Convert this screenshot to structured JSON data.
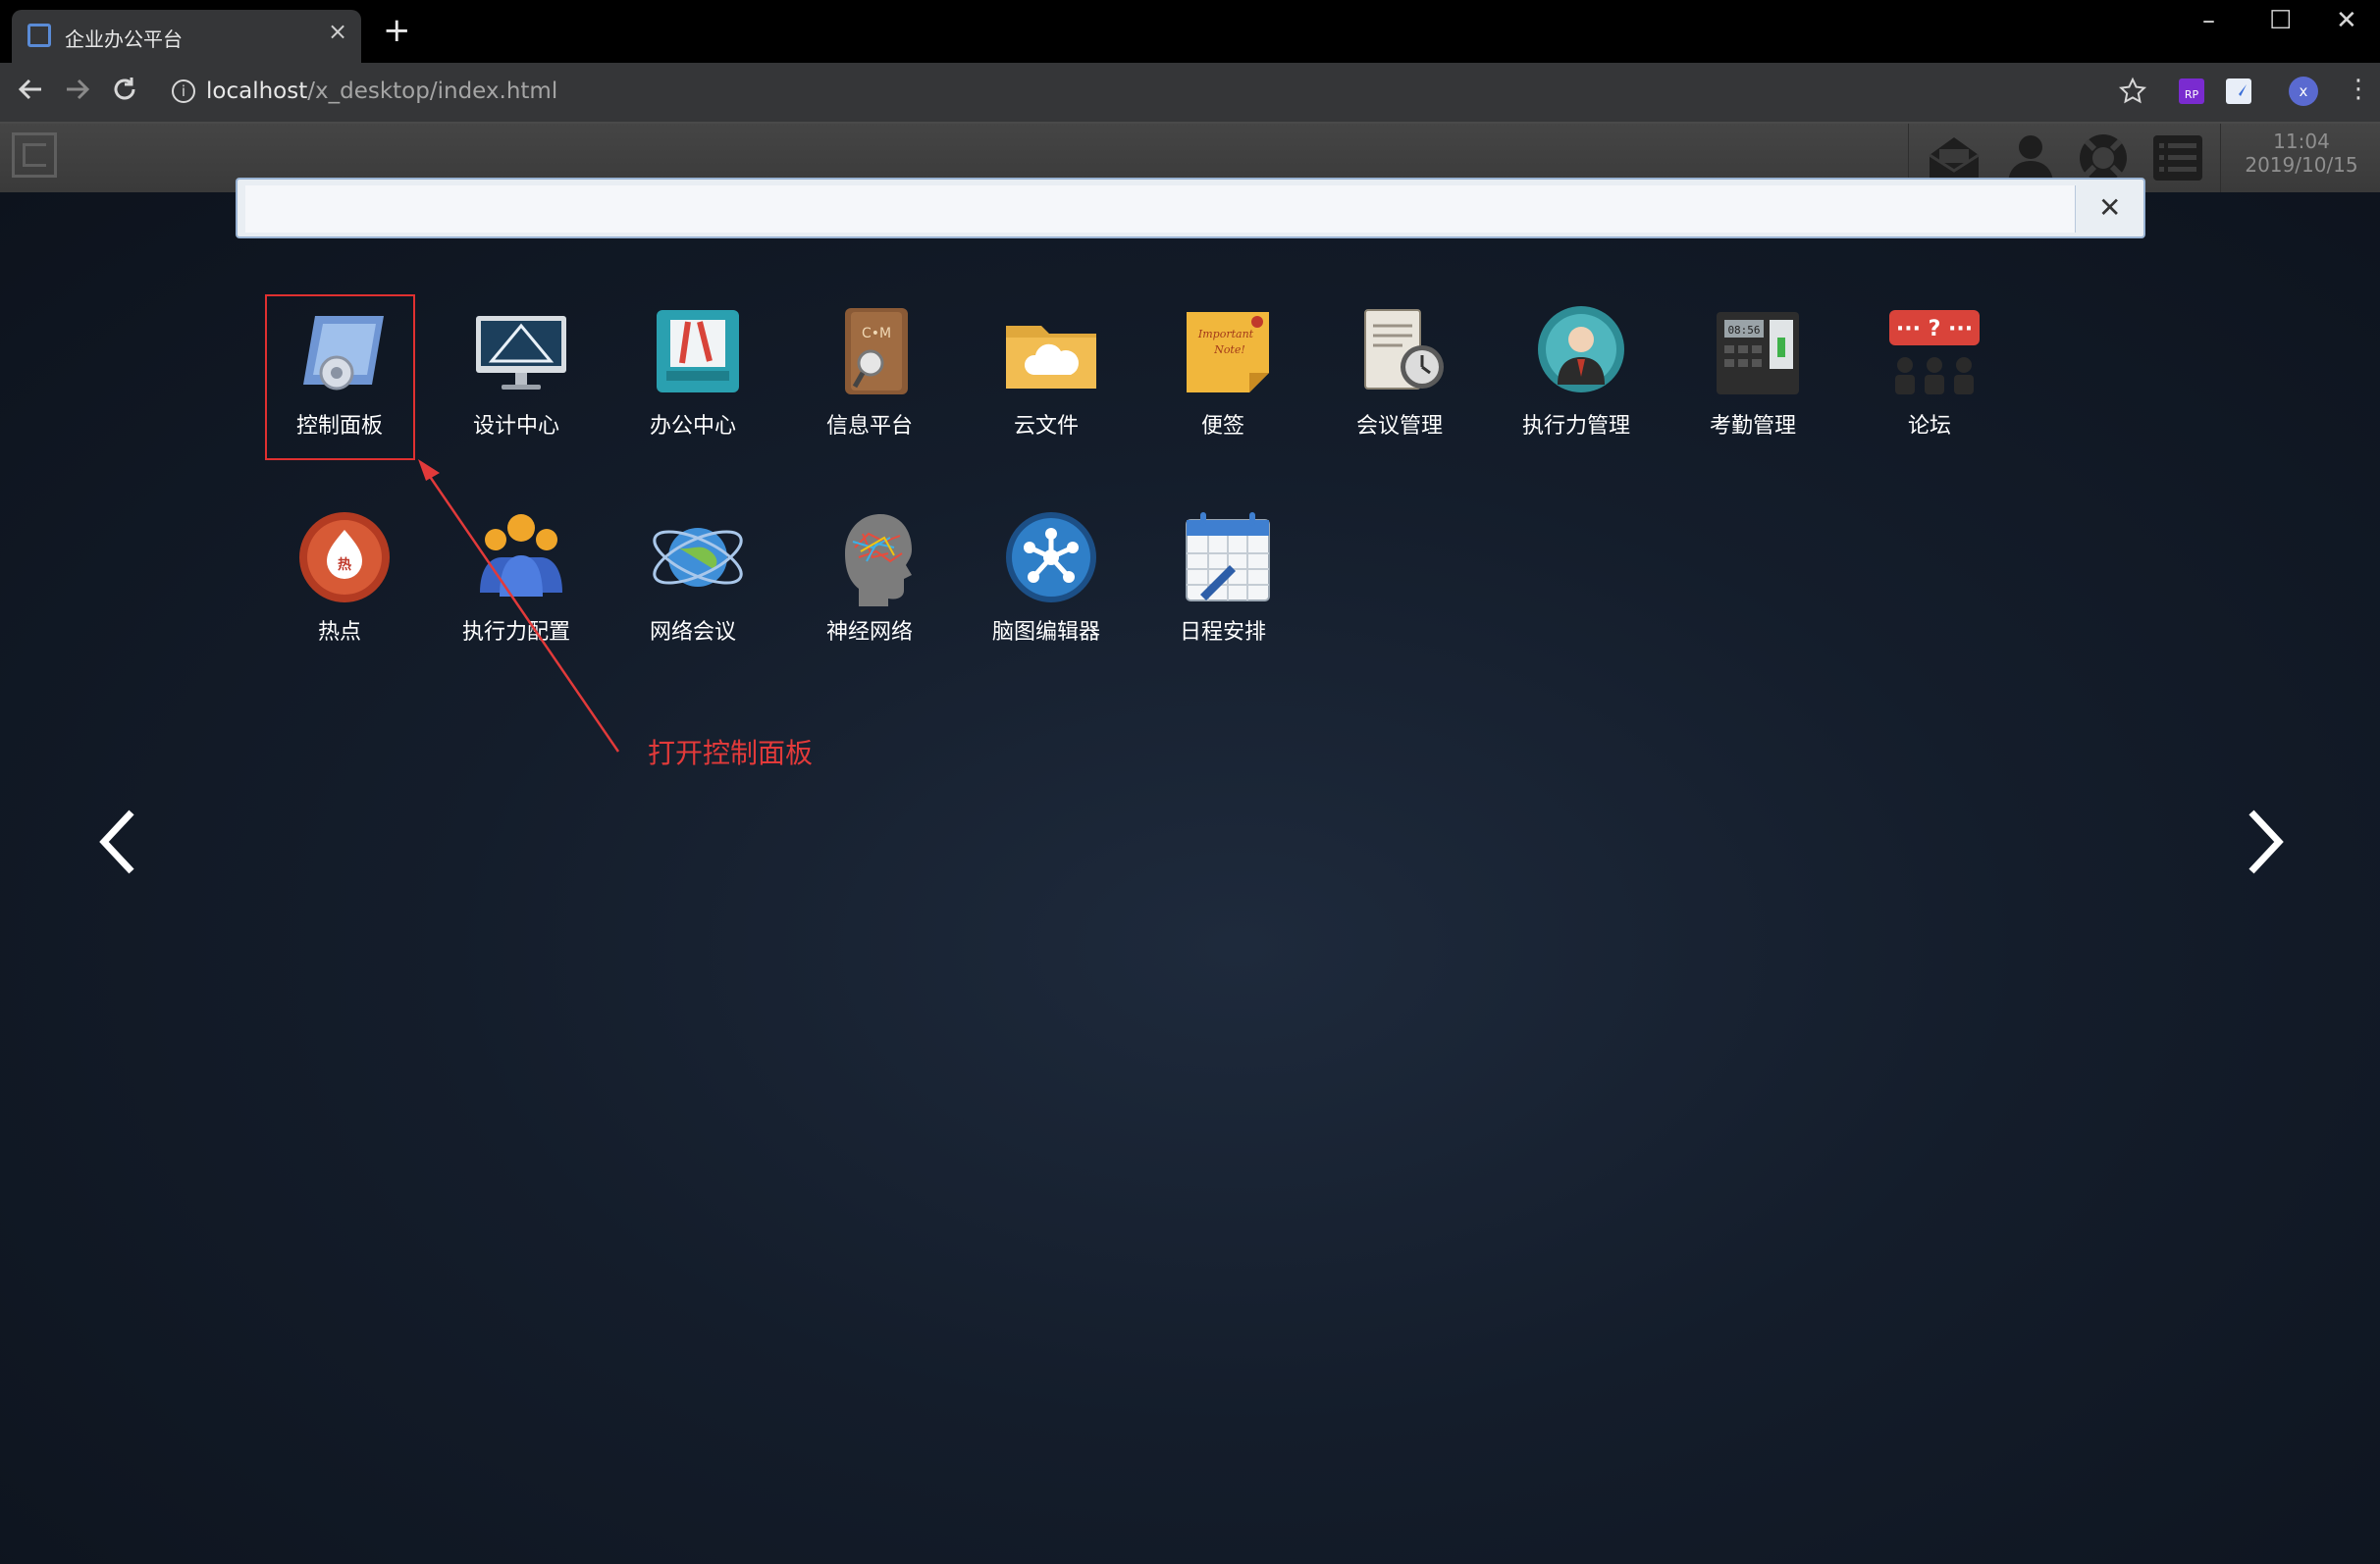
{
  "browser": {
    "tab_title": "企业办公平台",
    "tab_close": "×",
    "new_tab": "+",
    "url_host": "localhost",
    "url_path": "/x_desktop/index.html",
    "window_controls": [
      "–",
      "☐",
      "✕"
    ]
  },
  "app_header": {
    "time": "11:04",
    "date": "2019/10/15",
    "icons": [
      "mail-icon",
      "user-icon",
      "lifebuoy-icon",
      "list-icon"
    ]
  },
  "search": {
    "value": "",
    "close_label": "✕"
  },
  "apps_row1": [
    {
      "label": "控制面板",
      "icon": "control-panel-icon"
    },
    {
      "label": "设计中心",
      "icon": "design-center-icon"
    },
    {
      "label": "办公中心",
      "icon": "office-center-icon"
    },
    {
      "label": "信息平台",
      "icon": "info-platform-icon"
    },
    {
      "label": "云文件",
      "icon": "cloud-file-icon"
    },
    {
      "label": "便签",
      "icon": "sticky-note-icon"
    },
    {
      "label": "会议管理",
      "icon": "meeting-icon"
    },
    {
      "label": "执行力管理",
      "icon": "execution-icon"
    },
    {
      "label": "考勤管理",
      "icon": "attendance-icon"
    },
    {
      "label": "论坛",
      "icon": "forum-icon"
    }
  ],
  "apps_row2": [
    {
      "label": "热点",
      "icon": "hotspot-icon"
    },
    {
      "label": "执行力配置",
      "icon": "execution-config-icon"
    },
    {
      "label": "网络会议",
      "icon": "network-meeting-icon"
    },
    {
      "label": "神经网络",
      "icon": "neural-network-icon"
    },
    {
      "label": "脑图编辑器",
      "icon": "mindmap-icon"
    },
    {
      "label": "日程安排",
      "icon": "calendar-icon"
    }
  ],
  "annotation": {
    "note": "打开控制面板",
    "color": "#e23a3a"
  },
  "colors": {
    "desktop_bg": "#141d2b",
    "header_bg": "#3f3f3f"
  }
}
